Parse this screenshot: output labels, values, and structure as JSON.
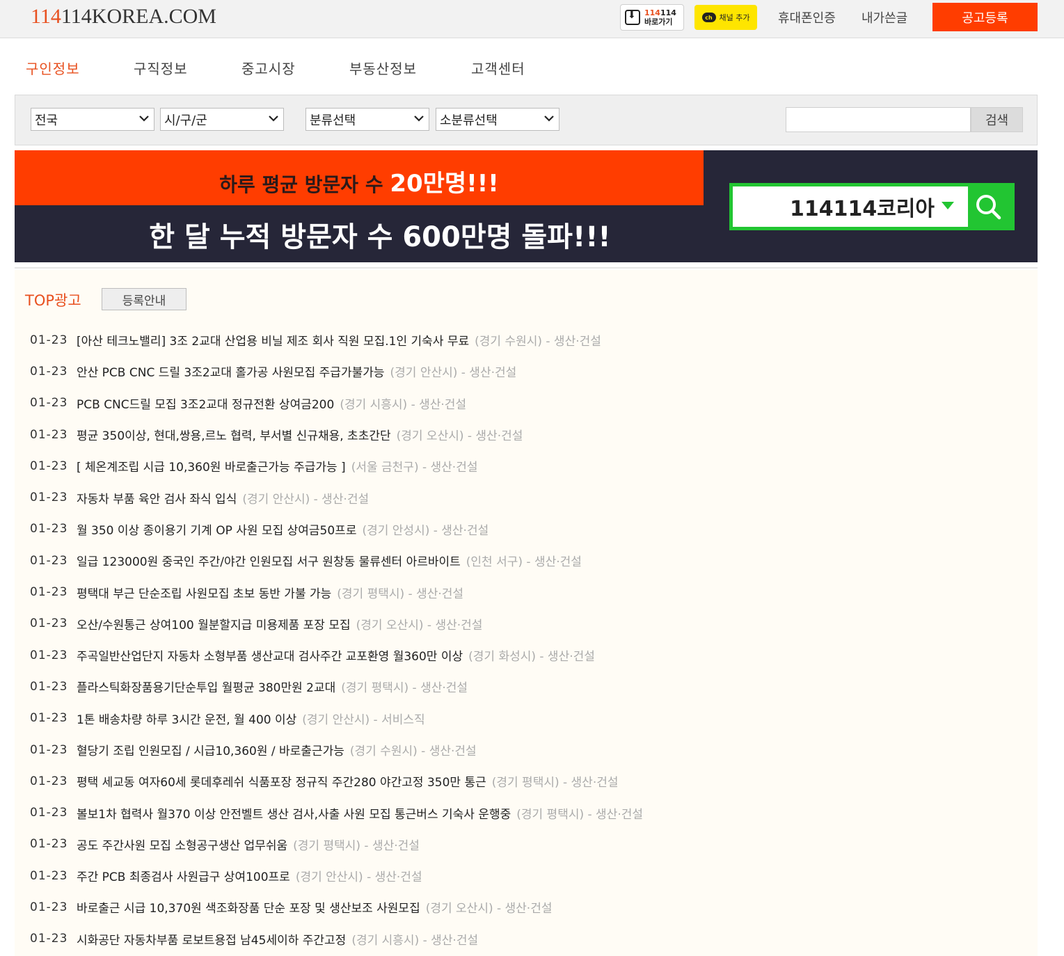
{
  "header": {
    "logo_accent": "114",
    "logo_rest": "114KOREA.COM",
    "app_button": {
      "line1_red": "114",
      "line1_rest": "114",
      "line2": "바로가기"
    },
    "kakao_button": {
      "badge": "ch",
      "label": "채널 추가"
    },
    "phone_auth": "휴대폰인증",
    "my_posts": "내가쓴글",
    "register": "공고등록"
  },
  "nav": {
    "items": [
      "구인정보",
      "구직정보",
      "중고시장",
      "부동산정보",
      "고객센터"
    ],
    "active_index": 0
  },
  "filters": {
    "region": "전국",
    "district": "시/구/군",
    "category": "분류선택",
    "subcategory": "소분류선택",
    "search_value": "",
    "search_button": "검색"
  },
  "banner": {
    "line1_prefix": "하루 평균 방문자 수 ",
    "line1_highlight": "20만명!!!",
    "line2": "한 달 누적 방문자 수 600만명 돌파!!!",
    "search_text": "114114코리아"
  },
  "top_ads": {
    "title": "TOP광고",
    "guide_button": "등록안내",
    "items": [
      {
        "date": "01-23",
        "title": "[아산 테크노밸리] 3조 2교대 산업용 비닐 제조 회사 직원 모집.1인 기숙사 무료",
        "meta": "(경기 수원시) - 생산·건설"
      },
      {
        "date": "01-23",
        "title": "안산 PCB CNC 드릴 3조2교대 홀가공 사원모집 주급가불가능",
        "meta": "(경기 안산시) - 생산·건설"
      },
      {
        "date": "01-23",
        "title": "PCB CNC드릴 모집 3조2교대 정규전환 상여금200",
        "meta": "(경기 시흥시) - 생산·건설"
      },
      {
        "date": "01-23",
        "title": "평균 350이상, 현대,쌍용,르노 협력, 부서별 신규채용, 초초간단",
        "meta": "(경기 오산시) - 생산·건설"
      },
      {
        "date": "01-23",
        "title": "[ 체온계조립 시급 10,360원 바로출근가능 주급가능 ]",
        "meta": "(서울 금천구) - 생산·건설"
      },
      {
        "date": "01-23",
        "title": "자동차 부품 육안 검사 좌식 입식",
        "meta": "(경기 안산시) - 생산·건설"
      },
      {
        "date": "01-23",
        "title": "월 350 이상 종이용기 기계 OP 사원 모집 상여금50프로",
        "meta": "(경기 안성시) - 생산·건설"
      },
      {
        "date": "01-23",
        "title": "일급 123000원 중국인 주간/야간 인원모집 서구 원창동 물류센터 아르바이트",
        "meta": "(인천 서구) - 생산·건설"
      },
      {
        "date": "01-23",
        "title": "평택대 부근 단순조립 사원모집 초보 동반 가불 가능",
        "meta": "(경기 평택시) - 생산·건설"
      },
      {
        "date": "01-23",
        "title": "오산/수원통근 상여100 월분할지급 미용제품 포장 모집",
        "meta": "(경기 오산시) - 생산·건설"
      },
      {
        "date": "01-23",
        "title": "주곡일반산업단지 자동차 소형부품 생산교대 검사주간 교포환영 월360만 이상",
        "meta": "(경기 화성시) - 생산·건설"
      },
      {
        "date": "01-23",
        "title": "플라스틱화장품용기단순투입 월평균 380만원 2교대",
        "meta": "(경기 평택시) - 생산·건설"
      },
      {
        "date": "01-23",
        "title": "1톤 배송차량 하루 3시간 운전, 월 400 이상",
        "meta": "(경기 안산시) - 서비스직"
      },
      {
        "date": "01-23",
        "title": "혈당기 조립 인원모집 / 시급10,360원 / 바로출근가능",
        "meta": "(경기 수원시) - 생산·건설"
      },
      {
        "date": "01-23",
        "title": "평택 세교동 여자60세 롯데후레쉬 식품포장 정규직 주간280 야간고정 350만 통근",
        "meta": "(경기 평택시) - 생산·건설"
      },
      {
        "date": "01-23",
        "title": "볼보1차 협력사 월370 이상 안전벨트 생산 검사,사출 사원 모집 통근버스 기숙사 운행중",
        "meta": "(경기 평택시) - 생산·건설"
      },
      {
        "date": "01-23",
        "title": "공도 주간사원 모집 소형공구생산 업무쉬움",
        "meta": "(경기 평택시) - 생산·건설"
      },
      {
        "date": "01-23",
        "title": "주간 PCB 최종검사 사원급구 상여100프로",
        "meta": "(경기 안산시) - 생산·건설"
      },
      {
        "date": "01-23",
        "title": "바로출근 시급 10,370원 색조화장품 단순 포장 및 생산보조 사원모집",
        "meta": "(경기 오산시) - 생산·건설"
      },
      {
        "date": "01-23",
        "title": "시화공단 자동차부품 로보트용접 남45세이하 주간고정",
        "meta": "(경기 시흥시) - 생산·건설"
      }
    ]
  },
  "colors": {
    "accent": "#e8501f",
    "register_bg": "#ff3d00",
    "kakao": "#fee500",
    "banner_dark": "#262638",
    "banner_search": "#22c532"
  }
}
